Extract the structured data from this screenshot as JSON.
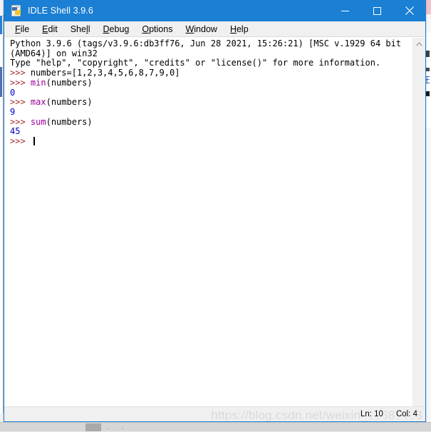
{
  "window": {
    "title": "IDLE Shell 3.9.6",
    "icon": "idle-python-file-icon",
    "controls": {
      "minimize": "minimize-icon",
      "maximize": "maximize-icon",
      "close": "close-icon"
    },
    "accent_color": "#1b7fd4",
    "border_color": "#1e7ad1"
  },
  "menubar": {
    "items": [
      {
        "label": "File",
        "mnemonic": "F"
      },
      {
        "label": "Edit",
        "mnemonic": "E"
      },
      {
        "label": "Shell",
        "mnemonic": "l"
      },
      {
        "label": "Debug",
        "mnemonic": "D"
      },
      {
        "label": "Options",
        "mnemonic": "O"
      },
      {
        "label": "Window",
        "mnemonic": "W"
      },
      {
        "label": "Help",
        "mnemonic": "H"
      }
    ]
  },
  "shell": {
    "banner_line_1": "Python 3.9.6 (tags/v3.9.6:db3ff76, Jun 28 2021, 15:26:21) [MSC v.1929 64 bit (AMD64)] on win32",
    "banner_line_2": "Type \"help\", \"copyright\", \"credits\" or \"license()\" for more information.",
    "prompt": ">>> ",
    "entries": [
      {
        "prompt": ">>> ",
        "code_plain": "numbers=[1,2,3,4,5,6,8,7,9,0]",
        "builtin": "",
        "code_after": "",
        "output": null
      },
      {
        "prompt": ">>> ",
        "code_plain": "",
        "builtin": "min",
        "code_after": "(numbers)",
        "output": "0"
      },
      {
        "prompt": ">>> ",
        "code_plain": "",
        "builtin": "max",
        "code_after": "(numbers)",
        "output": "9"
      },
      {
        "prompt": ">>> ",
        "code_plain": "",
        "builtin": "sum",
        "code_after": "(numbers)",
        "output": "45"
      }
    ],
    "colors": {
      "prompt": "#a52a2a",
      "builtin": "#9a009a",
      "output": "#0000cc",
      "normal": "#000000",
      "background": "#ffffff"
    }
  },
  "scrollbar": {
    "up_arrow": "chevron-up-icon"
  },
  "statusbar": {
    "line_label": "Ln: 10",
    "col_label": "Col: 4",
    "watermark": "https://blog.csdn.net/weixin_55685433"
  },
  "taskbar": {
    "dots": "· ·"
  }
}
